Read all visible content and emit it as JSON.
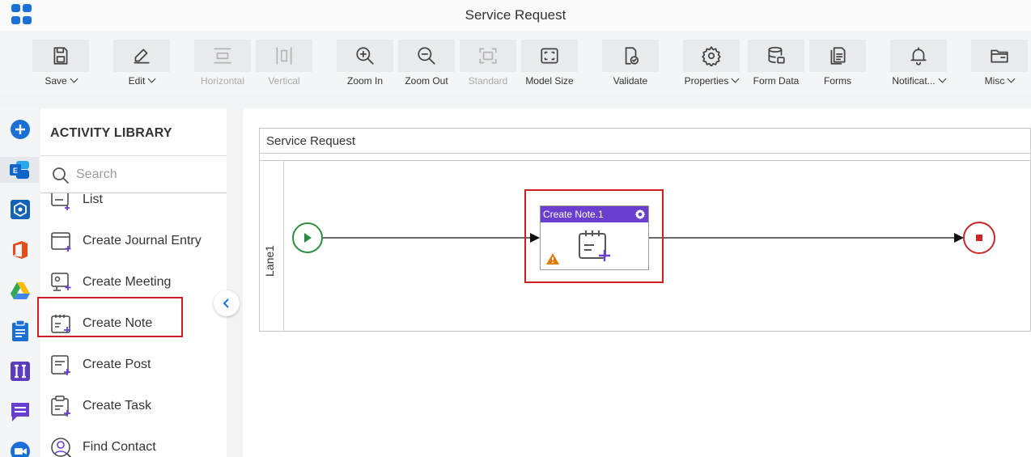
{
  "app": {
    "title": "Service Request"
  },
  "toolbar": {
    "items": [
      {
        "label": "Save",
        "icon": "save-icon",
        "dropdown": true,
        "disabled": false
      },
      {
        "label": "Edit",
        "icon": "edit-icon",
        "dropdown": true,
        "disabled": false
      },
      {
        "label": "Horizontal",
        "icon": "horizontal-icon",
        "dropdown": false,
        "disabled": true
      },
      {
        "label": "Vertical",
        "icon": "vertical-icon",
        "dropdown": false,
        "disabled": true
      },
      {
        "label": "Zoom In",
        "icon": "zoom-in-icon",
        "dropdown": false,
        "disabled": false
      },
      {
        "label": "Zoom Out",
        "icon": "zoom-out-icon",
        "dropdown": false,
        "disabled": false
      },
      {
        "label": "Standard",
        "icon": "standard-icon",
        "dropdown": false,
        "disabled": true
      },
      {
        "label": "Model Size",
        "icon": "model-size-icon",
        "dropdown": false,
        "disabled": false
      },
      {
        "label": "Validate",
        "icon": "validate-icon",
        "dropdown": false,
        "disabled": false
      },
      {
        "label": "Properties",
        "icon": "gear-icon",
        "dropdown": true,
        "disabled": false
      },
      {
        "label": "Form Data",
        "icon": "database-icon",
        "dropdown": false,
        "disabled": false
      },
      {
        "label": "Forms",
        "icon": "forms-icon",
        "dropdown": false,
        "disabled": false
      },
      {
        "label": "Notificat...",
        "icon": "bell-icon",
        "dropdown": true,
        "disabled": false
      },
      {
        "label": "Misc",
        "icon": "folder-icon",
        "dropdown": true,
        "disabled": false
      }
    ]
  },
  "rail": {
    "items": [
      {
        "name": "add-icon",
        "color": "#1b6fd6"
      },
      {
        "name": "exchange-icon",
        "color": "#1b6fd6",
        "active": true
      },
      {
        "name": "shield-app-icon",
        "color": "#1563b8"
      },
      {
        "name": "office-icon",
        "color": "#e64a19"
      },
      {
        "name": "drive-icon",
        "color": "#34a853"
      },
      {
        "name": "clipboard-icon",
        "color": "#1b6fd6"
      },
      {
        "name": "ii-app-icon",
        "color": "#6a3fd0"
      },
      {
        "name": "chat-icon",
        "color": "#6a3fd0"
      },
      {
        "name": "video-icon",
        "color": "#1b6fd6"
      }
    ]
  },
  "library": {
    "title": "ACTIVITY LIBRARY",
    "search_placeholder": "Search",
    "items": [
      {
        "label": "List"
      },
      {
        "label": "Create Journal Entry"
      },
      {
        "label": "Create Meeting"
      },
      {
        "label": "Create Note"
      },
      {
        "label": "Create Post"
      },
      {
        "label": "Create Task"
      },
      {
        "label": "Find Contact"
      }
    ]
  },
  "canvas": {
    "pool_title": "Service Request",
    "lane_label": "Lane1",
    "task_title": "Create Note.1"
  },
  "colors": {
    "accent": "#6a3fd0",
    "start": "#2e8b3e",
    "end": "#c62828",
    "highlight": "#d01f1f",
    "warning": "#e07b00"
  }
}
